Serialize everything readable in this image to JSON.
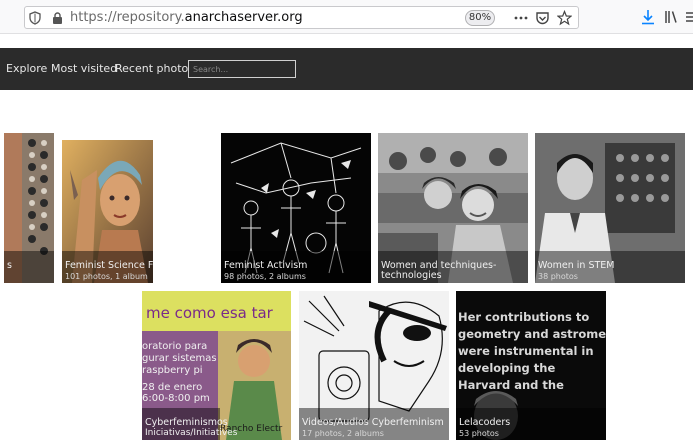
{
  "browser": {
    "url_scheme": "https://repository.",
    "url_host": "anarchaserver.org",
    "zoom": "80%"
  },
  "nav": {
    "links": [
      "Explore",
      "Most visited",
      "Recent photos"
    ],
    "search_placeholder": "Search..."
  },
  "albums": [
    {
      "title": "s",
      "count": ""
    },
    {
      "title": "Feminist Science Fiction",
      "count": "101 photos, 1 album"
    },
    {
      "title": "Feminist Activism",
      "count": "98 photos, 2 albums"
    },
    {
      "title": "Women and techniques-",
      "title2": "technologies",
      "count": ""
    },
    {
      "title": "Women in STEM",
      "count": "38 photos"
    },
    {
      "title": "Cyberfeminismos",
      "title2": "Iniciativas/Initiatives",
      "count": ""
    },
    {
      "title": "Videos/Audios Cyberfeminism",
      "count": "17 photos, 2 albums"
    },
    {
      "title": "Lelacoders",
      "count": "53 photos"
    }
  ],
  "poster_text": {
    "banner": "me como esa tar",
    "body_lines": [
      "oratorio para",
      "gurar sistemas",
      "raspberry pi",
      "28 de enero",
      "6:00-8:00 pm"
    ],
    "right": "Rancho Electr"
  },
  "quote_text": {
    "lines": [
      "Her contributions to",
      "geometry and astrometry",
      "were instrumental in",
      "developing the",
      "Harvard and the"
    ]
  }
}
